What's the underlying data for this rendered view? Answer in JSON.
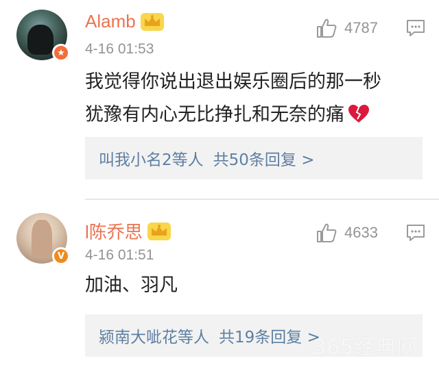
{
  "colors": {
    "username": "#eb7350",
    "meta": "#939393",
    "link": "#5d7fa3",
    "reply_bg": "#f2f2f2"
  },
  "comments": [
    {
      "username": "Alamb",
      "timestamp": "4-16 01:53",
      "likes": "4787",
      "badge": "★",
      "lines": [
        "我觉得你说出退出娱乐圈后的那一秒",
        "犹豫有内心无比挣扎和无奈的痛"
      ],
      "emoji": "broken-heart-icon",
      "reply_users": "叫我小名2等人",
      "reply_count": "共50条回复 >"
    },
    {
      "username": "l陈乔思",
      "timestamp": "4-16 01:51",
      "likes": "4633",
      "badge": "V",
      "lines": [
        "加油、羽凡"
      ],
      "reply_users": "颍南大呲花等人",
      "reply_count": "共19条回复 >"
    }
  ],
  "watermark": "365经典网"
}
